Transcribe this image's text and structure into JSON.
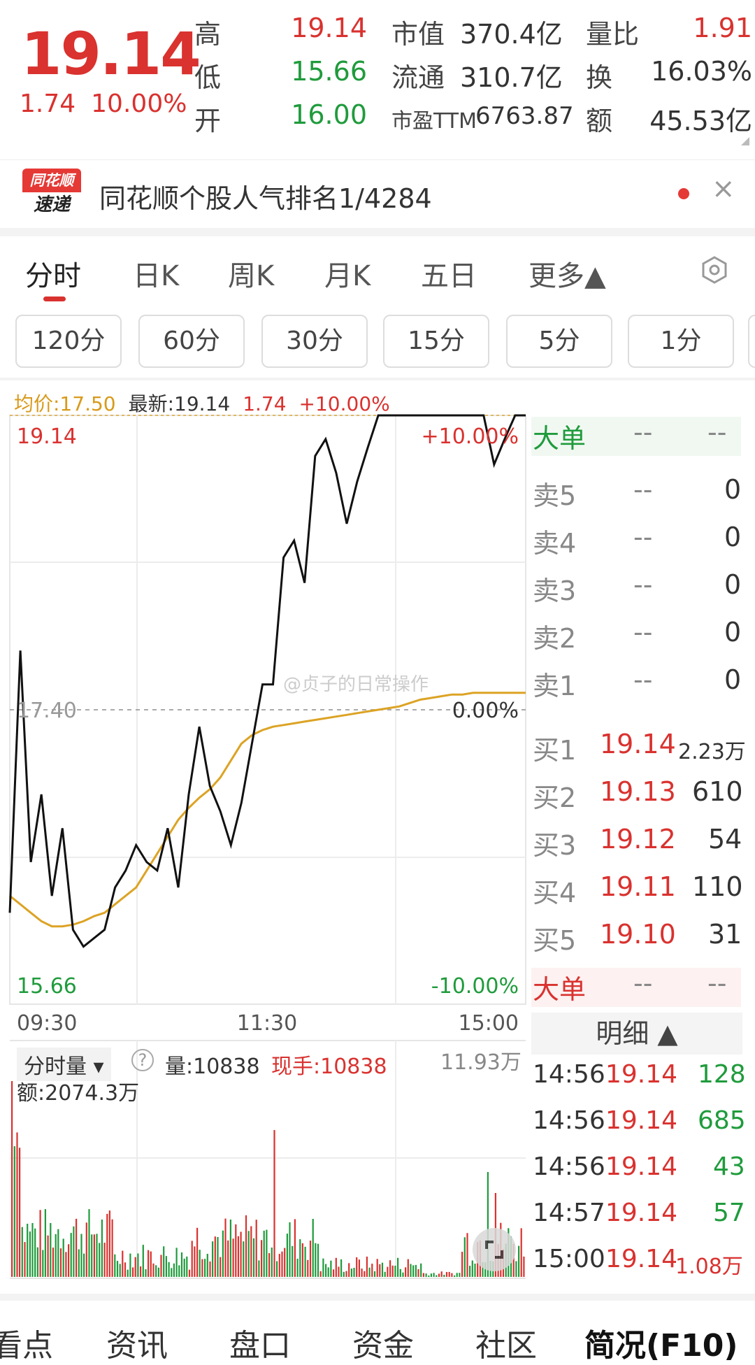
{
  "quote": {
    "price": "19.14",
    "change": "1.74",
    "change_pct": "10.00%",
    "stats": [
      {
        "label": "高",
        "value": "19.14",
        "color": "red"
      },
      {
        "label": "低",
        "value": "15.66",
        "color": "green"
      },
      {
        "label": "开",
        "value": "16.00",
        "color": "green"
      },
      {
        "label": "市值",
        "value": "370.4亿"
      },
      {
        "label": "流通",
        "value": "310.7亿"
      },
      {
        "label": "市盈TTM",
        "value": "6763.87"
      },
      {
        "label": "量比",
        "value": "1.91",
        "color": "red"
      },
      {
        "label": "换",
        "value": "16.03%"
      },
      {
        "label": "额",
        "value": "45.53亿"
      }
    ]
  },
  "news": {
    "logo_top": "同花顺",
    "logo_bottom": "速递",
    "text": "同花顺个股人气排名1/4284"
  },
  "tabs": [
    "分时",
    "日K",
    "周K",
    "月K",
    "五日",
    "更多▲"
  ],
  "periods": [
    "120分",
    "60分",
    "30分",
    "15分",
    "5分",
    "1分"
  ],
  "chart_header": {
    "avg": "均价:17.50",
    "latest": "最新:19.14",
    "chg": "1.74",
    "pct": "+10.00%"
  },
  "chart_data": {
    "type": "line",
    "price_top": "19.14",
    "price_mid": "17.40",
    "price_bottom": "15.66",
    "pct_top": "+10.00%",
    "pct_mid": "0.00%",
    "pct_bottom": "-10.00%",
    "x_ticks": [
      "09:30",
      "11:30",
      "15:00"
    ],
    "ylim": [
      15.66,
      19.14
    ],
    "price_series": [
      16.2,
      17.75,
      16.5,
      16.9,
      16.3,
      16.7,
      16.1,
      16.0,
      16.05,
      16.1,
      16.35,
      16.45,
      16.6,
      16.5,
      16.45,
      16.7,
      16.35,
      16.9,
      17.3,
      16.95,
      16.8,
      16.6,
      16.85,
      17.2,
      17.55,
      17.55,
      18.3,
      18.4,
      18.15,
      18.9,
      19.0,
      18.8,
      18.5,
      18.75,
      18.95,
      19.14,
      19.14,
      19.14,
      19.14,
      19.14,
      19.14,
      19.14,
      19.14,
      19.14,
      19.14,
      19.14,
      18.85,
      19.0,
      19.14,
      19.14
    ],
    "avg_series": [
      16.3,
      16.25,
      16.2,
      16.15,
      16.12,
      16.12,
      16.13,
      16.15,
      16.18,
      16.2,
      16.25,
      16.3,
      16.35,
      16.45,
      16.55,
      16.65,
      16.75,
      16.82,
      16.88,
      16.93,
      17.0,
      17.1,
      17.2,
      17.25,
      17.28,
      17.3,
      17.31,
      17.32,
      17.33,
      17.34,
      17.35,
      17.36,
      17.37,
      17.38,
      17.39,
      17.4,
      17.41,
      17.42,
      17.44,
      17.46,
      17.47,
      17.48,
      17.49,
      17.49,
      17.5,
      17.5,
      17.5,
      17.5,
      17.5,
      17.5
    ]
  },
  "order_book": {
    "big_label": "大单",
    "dash": "--",
    "asks": [
      {
        "label": "卖5",
        "price": "--",
        "vol": "0"
      },
      {
        "label": "卖4",
        "price": "--",
        "vol": "0"
      },
      {
        "label": "卖3",
        "price": "--",
        "vol": "0"
      },
      {
        "label": "卖2",
        "price": "--",
        "vol": "0"
      },
      {
        "label": "卖1",
        "price": "--",
        "vol": "0"
      }
    ],
    "bids": [
      {
        "label": "买1",
        "price": "19.14",
        "vol": "2.23万"
      },
      {
        "label": "买2",
        "price": "19.13",
        "vol": "610"
      },
      {
        "label": "买3",
        "price": "19.12",
        "vol": "54"
      },
      {
        "label": "买4",
        "price": "19.11",
        "vol": "110"
      },
      {
        "label": "买5",
        "price": "19.10",
        "vol": "31"
      }
    ]
  },
  "detail": {
    "title": "明细 ▲",
    "rows": [
      {
        "time": "14:56",
        "price": "19.14",
        "vol": "128",
        "color": "green"
      },
      {
        "time": "14:56",
        "price": "19.14",
        "vol": "685",
        "color": "green"
      },
      {
        "time": "14:56",
        "price": "19.14",
        "vol": "43",
        "color": "green"
      },
      {
        "time": "14:57",
        "price": "19.14",
        "vol": "57",
        "color": "green"
      },
      {
        "time": "15:00",
        "price": "19.14",
        "vol": "1.08万",
        "color": "red"
      }
    ]
  },
  "volume": {
    "selector": "分时量 ▾",
    "help": "?",
    "amount_label": "量:10838",
    "now_hand": "现手:10838",
    "max": "11.93万",
    "amount": "额:2074.3万"
  },
  "watermark": "@贞子的日常操作",
  "bottom_nav": [
    "看点",
    "资讯",
    "盘口",
    "资金",
    "社区",
    "简况(F10)"
  ]
}
